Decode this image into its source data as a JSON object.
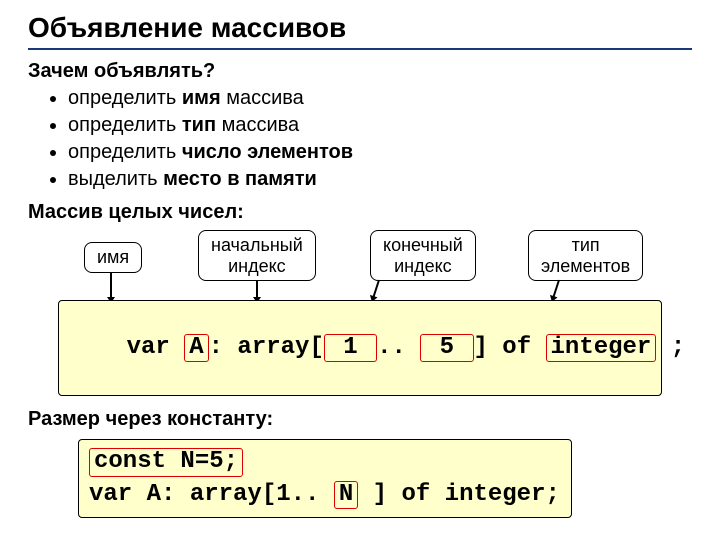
{
  "title": "Объявление массивов",
  "why": {
    "heading": "Зачем объявлять?",
    "items": [
      {
        "prefix": "определить ",
        "bold": "имя",
        "suffix": " массива"
      },
      {
        "prefix": "определить ",
        "bold": "тип",
        "suffix": " массива"
      },
      {
        "prefix": "определить ",
        "bold": "число элементов",
        "suffix": ""
      },
      {
        "prefix": "выделить ",
        "bold": "место в памяти",
        "suffix": ""
      }
    ]
  },
  "int_array_heading": "Массив целых чисел:",
  "labels": {
    "name": "имя",
    "start": "начальный\nиндекс",
    "end": "конечный\nиндекс",
    "type": "тип\nэлементов"
  },
  "code1": {
    "p1": "var ",
    "hl1": "A",
    "p2": ": array[",
    "hl2": " 1 ",
    "p3": ".. ",
    "hl3": " 5 ",
    "p4": "] of ",
    "hl4": "integer",
    "p5": " ;"
  },
  "const_heading": "Размер через константу:",
  "code2": {
    "l1a": " ",
    "l1hl": "const N=5;",
    "l2a": "var A: array[1.. ",
    "l2hl": "N",
    "l2b": " ] of integer;"
  }
}
